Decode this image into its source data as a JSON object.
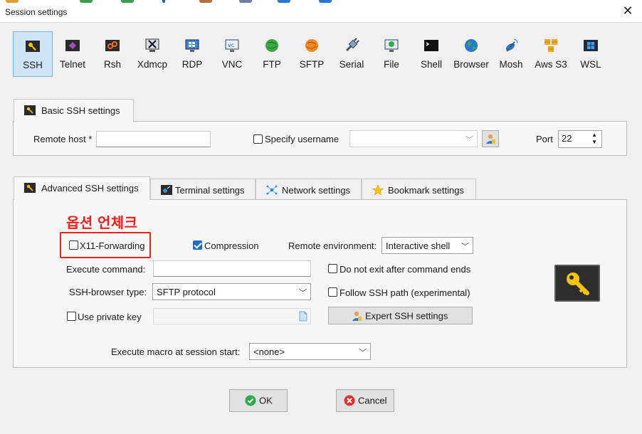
{
  "window": {
    "title": "Session settings"
  },
  "protocols": [
    {
      "label": "SSH",
      "icon": "ssh-key-icon",
      "active": true
    },
    {
      "label": "Telnet",
      "icon": "telnet-icon",
      "active": false
    },
    {
      "label": "Rsh",
      "icon": "rsh-icon",
      "active": false
    },
    {
      "label": "Xdmcp",
      "icon": "xdmcp-icon",
      "active": false
    },
    {
      "label": "RDP",
      "icon": "rdp-monitor-icon",
      "active": false
    },
    {
      "label": "VNC",
      "icon": "vnc-monitor-icon",
      "active": false
    },
    {
      "label": "FTP",
      "icon": "ftp-globe-icon",
      "active": false
    },
    {
      "label": "SFTP",
      "icon": "sftp-globe-icon",
      "active": false
    },
    {
      "label": "Serial",
      "icon": "serial-plug-icon",
      "active": false
    },
    {
      "label": "File",
      "icon": "file-monitor-icon",
      "active": false
    },
    {
      "label": "Shell",
      "icon": "shell-terminal-icon",
      "active": false
    },
    {
      "label": "Browser",
      "icon": "browser-globe-icon",
      "active": false
    },
    {
      "label": "Mosh",
      "icon": "mosh-satellite-icon",
      "active": false
    },
    {
      "label": "Aws S3",
      "icon": "aws-s3-cubes-icon",
      "active": false
    },
    {
      "label": "WSL",
      "icon": "wsl-windows-icon",
      "active": false
    }
  ],
  "basic": {
    "tab_label": "Basic SSH settings",
    "remote_host_label": "Remote host *",
    "remote_host_value": "",
    "specify_username_label": "Specify username",
    "specify_username_checked": false,
    "username_value": "",
    "port_label": "Port",
    "port_value": "22"
  },
  "tabs": [
    {
      "label": "Advanced SSH settings",
      "icon": "ssh-key-icon",
      "active": true
    },
    {
      "label": "Terminal settings",
      "icon": "terminal-icon",
      "active": false
    },
    {
      "label": "Network settings",
      "icon": "network-icon",
      "active": false
    },
    {
      "label": "Bookmark settings",
      "icon": "star-icon",
      "active": false
    }
  ],
  "advanced": {
    "annotation_text": "옵션 언체크",
    "x11_label": "X11-Forwarding",
    "x11_checked": false,
    "compression_label": "Compression",
    "compression_checked": true,
    "remote_env_label": "Remote environment:",
    "remote_env_value": "Interactive shell",
    "execute_command_label": "Execute command:",
    "execute_command_value": "",
    "do_not_exit_label": "Do not exit after command ends",
    "do_not_exit_checked": false,
    "browser_type_label": "SSH-browser type:",
    "browser_type_value": "SFTP protocol",
    "follow_path_label": "Follow SSH path (experimental)",
    "follow_path_checked": false,
    "private_key_label": "Use private key",
    "private_key_checked": false,
    "private_key_value": "",
    "expert_button_label": "Expert SSH settings",
    "macro_label": "Execute macro at session start:",
    "macro_value": "<none>"
  },
  "footer": {
    "ok_label": "OK",
    "cancel_label": "Cancel"
  },
  "colors": {
    "accent": "#1f6fc4",
    "annotation": "#ff1a1a",
    "ok_green": "#2eaa4a",
    "cancel_red": "#e03030",
    "key_yellow": "#f5c400"
  }
}
